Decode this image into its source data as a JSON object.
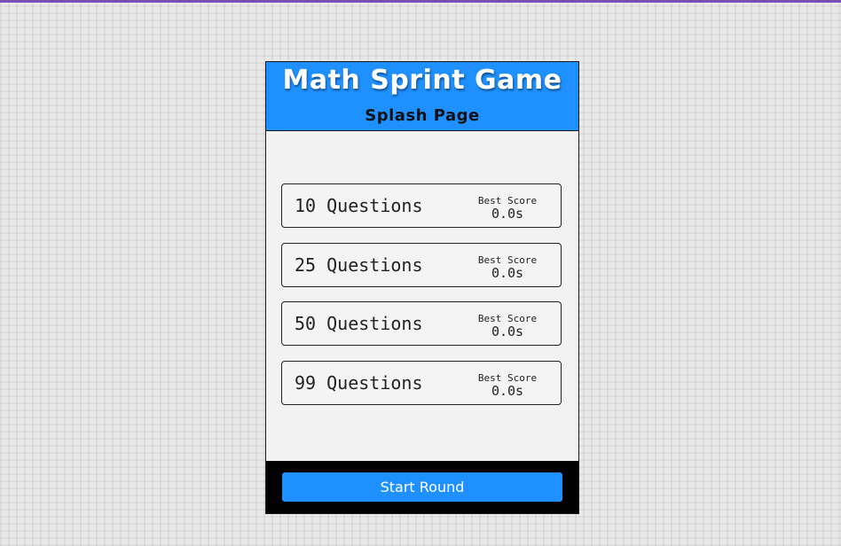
{
  "header": {
    "title": "Math Sprint Game",
    "subtitle": "Splash Page"
  },
  "options": [
    {
      "label": "10 Questions",
      "best_caption": "Best Score",
      "best_value": "0.0s"
    },
    {
      "label": "25 Questions",
      "best_caption": "Best Score",
      "best_value": "0.0s"
    },
    {
      "label": "50 Questions",
      "best_caption": "Best Score",
      "best_value": "0.0s"
    },
    {
      "label": "99 Questions",
      "best_caption": "Best Score",
      "best_value": "0.0s"
    }
  ],
  "footer": {
    "start_label": "Start Round"
  },
  "colors": {
    "accent": "#1e90ff",
    "footer": "#000000",
    "top_line": "#7a4fb8"
  }
}
